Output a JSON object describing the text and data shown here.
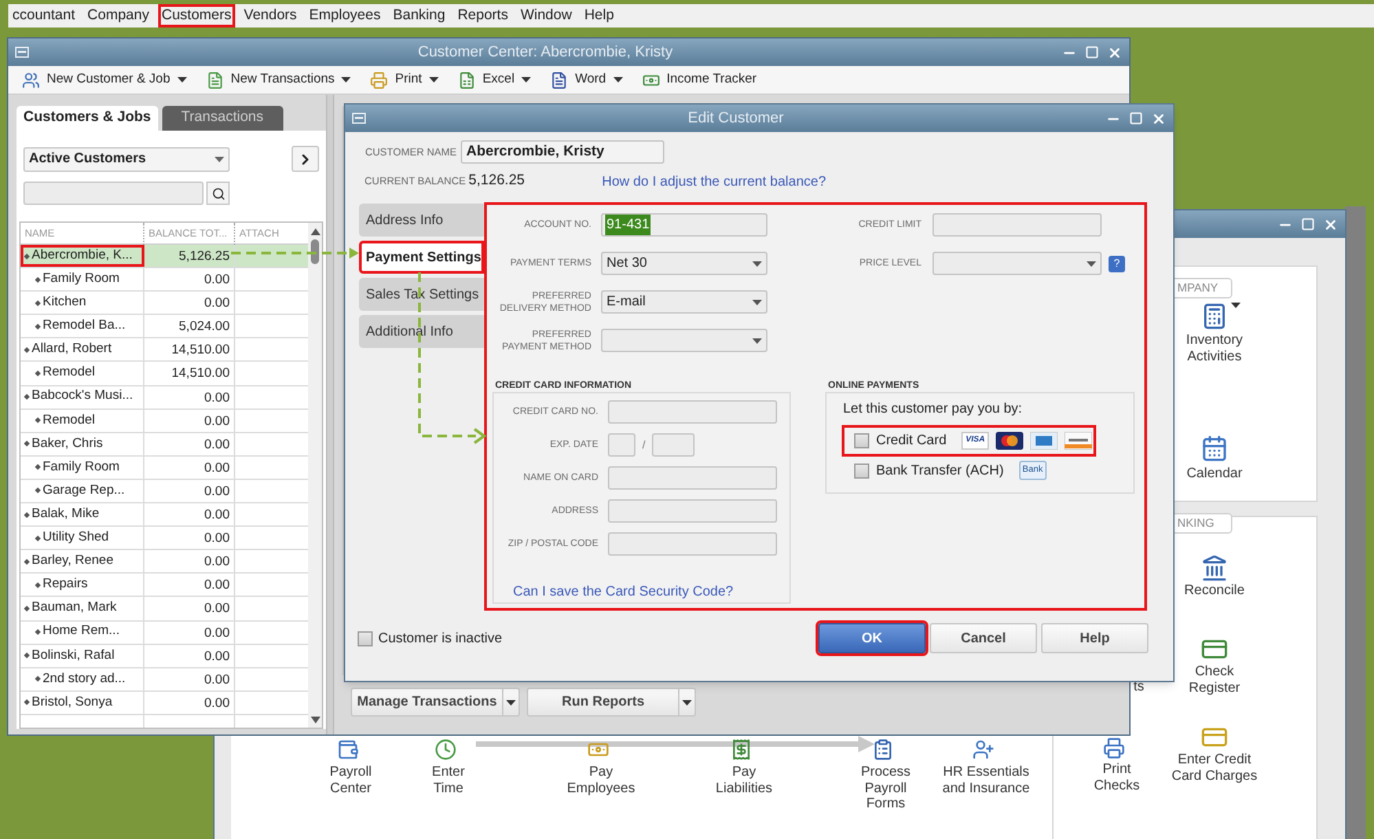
{
  "menu_bar": [
    {
      "label": "ccountant",
      "highlighted": false
    },
    {
      "label": "Company",
      "highlighted": false
    },
    {
      "label": "Customers",
      "highlighted": true
    },
    {
      "label": "Vendors",
      "highlighted": false
    },
    {
      "label": "Employees",
      "highlighted": false
    },
    {
      "label": "Banking",
      "highlighted": false
    },
    {
      "label": "Reports",
      "highlighted": false
    },
    {
      "label": "Window",
      "highlighted": false
    },
    {
      "label": "Help",
      "highlighted": false
    }
  ],
  "customer_center": {
    "title": "Customer Center: Abercrombie, Kristy",
    "toolbar": [
      {
        "label": "New Customer & Job",
        "kind": "customer",
        "dropdown": true
      },
      {
        "label": "New Transactions",
        "kind": "transactions",
        "dropdown": true
      },
      {
        "label": "Print",
        "kind": "print",
        "dropdown": true
      },
      {
        "label": "Excel",
        "kind": "excel",
        "dropdown": true
      },
      {
        "label": "Word",
        "kind": "word",
        "dropdown": true
      },
      {
        "label": "Income Tracker",
        "kind": "tracker",
        "dropdown": false
      }
    ],
    "tabs": [
      {
        "label": "Customers & Jobs",
        "selected": true
      },
      {
        "label": "Transactions",
        "selected": false
      }
    ],
    "filter": "Active Customers",
    "table": {
      "columns": [
        "NAME",
        "BALANCE TOT...",
        "ATTACH"
      ],
      "rows": [
        {
          "name": "Abercrombie, K...",
          "balance": "5,126.25",
          "selected": true,
          "highlighted": true,
          "children": [
            {
              "name": "Family Room",
              "balance": "0.00",
              "selected": false,
              "highlighted": false
            },
            {
              "name": "Kitchen",
              "balance": "0.00",
              "selected": false,
              "highlighted": false
            },
            {
              "name": "Remodel Ba...",
              "balance": "5,024.00",
              "selected": false,
              "highlighted": false
            }
          ]
        },
        {
          "name": "Allard, Robert",
          "balance": "14,510.00",
          "selected": false,
          "highlighted": false,
          "children": [
            {
              "name": "Remodel",
              "balance": "14,510.00",
              "selected": false,
              "highlighted": false
            }
          ]
        },
        {
          "name": "Babcock's Musi...",
          "balance": "0.00",
          "selected": false,
          "highlighted": false,
          "children": [
            {
              "name": "Remodel",
              "balance": "0.00",
              "selected": false,
              "highlighted": false
            }
          ]
        },
        {
          "name": "Baker, Chris",
          "balance": "0.00",
          "selected": false,
          "highlighted": false,
          "children": [
            {
              "name": "Family Room",
              "balance": "0.00",
              "selected": false,
              "highlighted": false
            },
            {
              "name": "Garage Rep...",
              "balance": "0.00",
              "selected": false,
              "highlighted": false
            }
          ]
        },
        {
          "name": "Balak, Mike",
          "balance": "0.00",
          "selected": false,
          "highlighted": false,
          "children": [
            {
              "name": "Utility Shed",
              "balance": "0.00",
              "selected": false,
              "highlighted": false
            }
          ]
        },
        {
          "name": "Barley, Renee",
          "balance": "0.00",
          "selected": false,
          "highlighted": false,
          "children": [
            {
              "name": "Repairs",
              "balance": "0.00",
              "selected": false,
              "highlighted": false
            }
          ]
        },
        {
          "name": "Bauman, Mark",
          "balance": "0.00",
          "selected": false,
          "highlighted": false,
          "children": [
            {
              "name": "Home Rem...",
              "balance": "0.00",
              "selected": false,
              "highlighted": false
            }
          ]
        },
        {
          "name": "Bolinski, Rafal",
          "balance": "0.00",
          "selected": false,
          "highlighted": false,
          "children": [
            {
              "name": "2nd story ad...",
              "balance": "0.00",
              "selected": false,
              "highlighted": false
            }
          ]
        },
        {
          "name": "Bristol, Sonya",
          "balance": "0.00",
          "selected": false,
          "highlighted": false
        }
      ]
    },
    "buttons": [
      {
        "label": "Manage Transactions"
      },
      {
        "label": "Run Reports"
      }
    ]
  },
  "edit_customer": {
    "title": "Edit Customer",
    "customer_name_label": "CUSTOMER NAME",
    "customer_name": "Abercrombie, Kristy",
    "balance_label": "CURRENT BALANCE",
    "balance": "5,126.25",
    "balance_link": "How do I adjust the current balance?",
    "tabs": [
      {
        "label": "Address Info",
        "selected": false,
        "highlighted": false
      },
      {
        "label": "Payment Settings",
        "selected": true,
        "highlighted": true
      },
      {
        "label": "Sales Tax Settings",
        "selected": false,
        "highlighted": false
      },
      {
        "label": "Additional Info",
        "selected": false,
        "highlighted": false
      }
    ],
    "panel": {
      "highlighted": true,
      "fields": [
        {
          "label": "ACCOUNT NO.",
          "kind": "text",
          "value": "91-431",
          "value_selected": true
        },
        {
          "label": "PAYMENT TERMS",
          "kind": "dropdown",
          "value": "Net 30"
        },
        {
          "label": "PREFERRED DELIVERY METHOD",
          "kind": "dropdown",
          "value": "E-mail"
        },
        {
          "label": "PREFERRED PAYMENT METHOD",
          "kind": "dropdown"
        }
      ],
      "right_fields": [
        {
          "label": "CREDIT LIMIT",
          "kind": "text"
        },
        {
          "label": "PRICE LEVEL",
          "kind": "dropdown",
          "help": "?"
        }
      ],
      "credit_card": {
        "title": "CREDIT CARD INFORMATION",
        "fields": [
          {
            "label": "CREDIT CARD NO.",
            "kind": "text"
          },
          {
            "label": "EXP. DATE",
            "kind": "date",
            "separator": "/"
          },
          {
            "label": "NAME ON CARD",
            "kind": "text"
          },
          {
            "label": "ADDRESS",
            "kind": "text"
          },
          {
            "label": "ZIP / POSTAL CODE",
            "kind": "text"
          }
        ],
        "link": "Can I save the Card Security Code?"
      },
      "online_payments": {
        "title": "ONLINE PAYMENTS",
        "prompt": "Let this customer pay you by:",
        "options": [
          {
            "label": "Credit Card",
            "checked": false,
            "highlighted": true,
            "logos": [
              {
                "kind": "visa",
                "label": "VISA"
              },
              {
                "kind": "mastercard"
              },
              {
                "kind": "amex"
              },
              {
                "kind": "discover"
              }
            ]
          },
          {
            "label": "Bank Transfer (ACH)",
            "checked": false,
            "highlighted": false,
            "logos": [
              {
                "kind": "bank",
                "label": "Bank"
              }
            ]
          }
        ]
      }
    },
    "inactive": {
      "label": "Customer is inactive",
      "checked": false
    },
    "buttons": [
      {
        "label": "OK",
        "kind": "primary",
        "highlighted": true
      },
      {
        "label": "Cancel",
        "kind": "default",
        "highlighted": false
      },
      {
        "label": "Help",
        "kind": "default",
        "highlighted": false
      }
    ]
  },
  "home": {
    "sections": [
      {
        "label": "MPANY"
      },
      {
        "label": "NKING"
      }
    ],
    "nodes": [
      {
        "label": "Inventory Activities",
        "kind": "inventory",
        "dropdown": true
      },
      {
        "label": "Calendar",
        "kind": "calendar",
        "dropdown": false
      },
      {
        "label": "Reconcile",
        "kind": "reconcile",
        "dropdown": false
      },
      {
        "label": "ts",
        "kind": "none"
      },
      {
        "label": "Check Register",
        "kind": "register",
        "dropdown": false
      },
      {
        "label": "Payroll Center",
        "kind": "payroll",
        "dropdown": false
      },
      {
        "label": "Enter Time",
        "kind": "time",
        "dropdown": false
      },
      {
        "label": "Pay Employees",
        "kind": "pay",
        "dropdown": false
      },
      {
        "label": "Pay Liabilities",
        "kind": "liabilities",
        "dropdown": false
      },
      {
        "label": "Process Payroll Forms",
        "kind": "forms",
        "dropdown": false
      },
      {
        "label": "HR Essentials and Insurance",
        "kind": "hr",
        "dropdown": false
      },
      {
        "label": "Print Checks",
        "kind": "print",
        "dropdown": false
      },
      {
        "label": "Enter Credit Card Charges",
        "kind": "charges",
        "dropdown": false
      }
    ]
  }
}
